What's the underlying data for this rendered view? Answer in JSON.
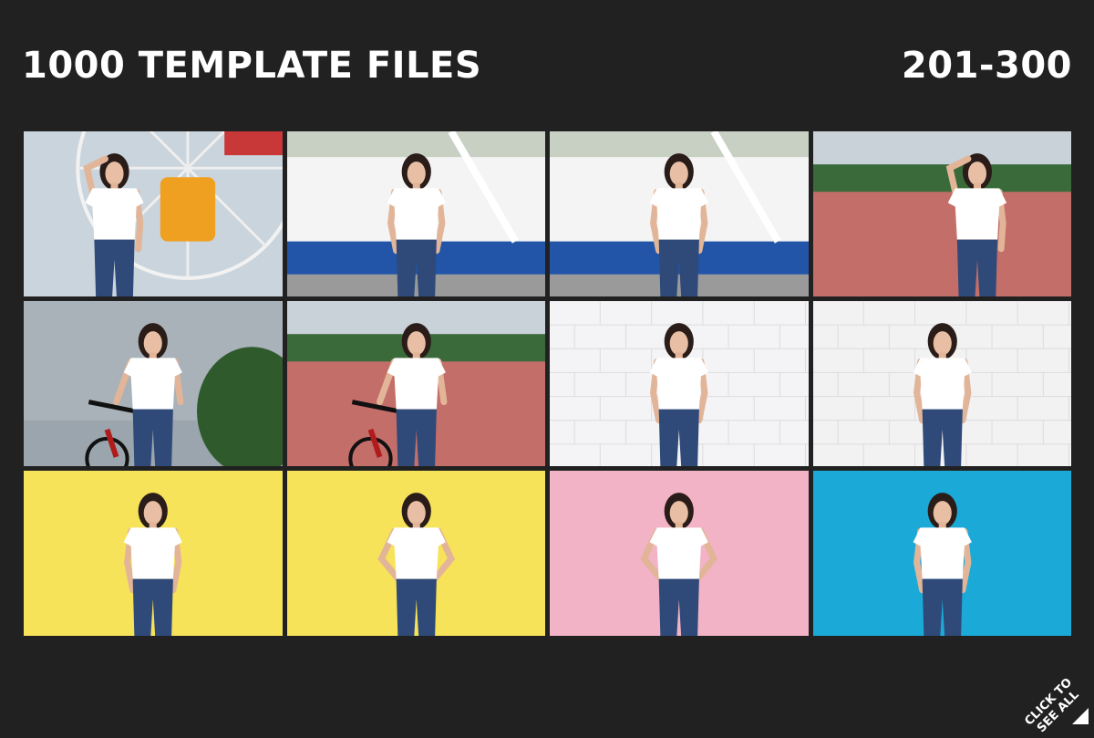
{
  "header": {
    "title": "1000 TEMPLATE FILES",
    "range": "201-300"
  },
  "cta": {
    "line1": "CLICK TO",
    "line2": "SEE ALL"
  },
  "tiles": [
    {
      "scene": "ferris-wheel",
      "bg": "#c9d4dc",
      "pose": "hand-on-head"
    },
    {
      "scene": "amusement-ride",
      "bg": "#b8c6cc",
      "pose": "standing"
    },
    {
      "scene": "amusement-ride",
      "bg": "#b8c6cc",
      "pose": "standing"
    },
    {
      "scene": "plaza-bicycle",
      "bg": "#c77d78",
      "pose": "hand-on-head"
    },
    {
      "scene": "sky-bicycle",
      "bg": "#9aa5ad",
      "pose": "bicycle"
    },
    {
      "scene": "plaza-bicycle",
      "bg": "#b88686",
      "pose": "bicycle"
    },
    {
      "scene": "white-brick-wall",
      "bg": "#f4f4f6",
      "pose": "hands-in-pockets"
    },
    {
      "scene": "white-brick-wall",
      "bg": "#f2f2f3",
      "pose": "hands-in-pockets"
    },
    {
      "scene": "yellow-backdrop",
      "bg": "#f6e35a",
      "pose": "arms-down"
    },
    {
      "scene": "yellow-backdrop",
      "bg": "#f6e35a",
      "pose": "hands-on-hips"
    },
    {
      "scene": "pink-backdrop",
      "bg": "#f2b3c6",
      "pose": "hands-on-hips"
    },
    {
      "scene": "blue-backdrop",
      "bg": "#1ba9d8",
      "pose": "hands-in-pockets"
    }
  ]
}
